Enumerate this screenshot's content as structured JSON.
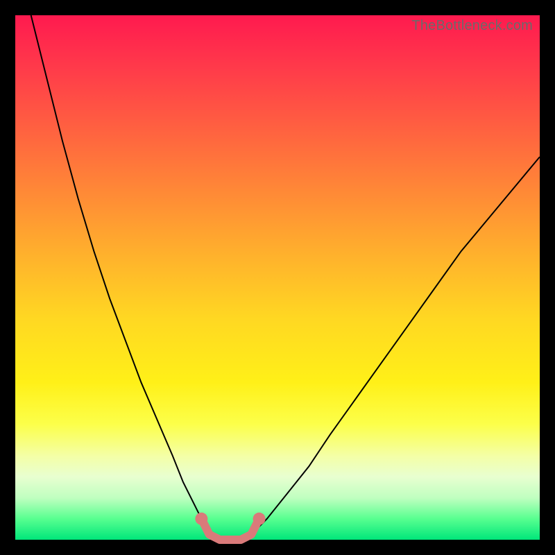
{
  "watermark": "TheBottleneck.com",
  "chart_data": {
    "type": "line",
    "title": "",
    "xlabel": "",
    "ylabel": "",
    "xlim": [
      0,
      100
    ],
    "ylim": [
      0,
      100
    ],
    "series": [
      {
        "name": "left-curve",
        "x": [
          3,
          6,
          9,
          12,
          15,
          18,
          21,
          24,
          27,
          30,
          32,
          34,
          35.5,
          37
        ],
        "values": [
          100,
          88,
          76,
          65,
          55,
          46,
          38,
          30,
          23,
          16,
          11,
          7,
          4,
          1
        ]
      },
      {
        "name": "right-curve",
        "x": [
          45,
          48,
          52,
          56,
          60,
          65,
          70,
          75,
          80,
          85,
          90,
          95,
          100
        ],
        "values": [
          1,
          4,
          9,
          14,
          20,
          27,
          34,
          41,
          48,
          55,
          61,
          67,
          73
        ]
      },
      {
        "name": "bottom-segment-pink",
        "x": [
          35.5,
          37,
          39,
          41,
          43,
          45,
          46.5
        ],
        "values": [
          4,
          1,
          0,
          0,
          0,
          1,
          4
        ]
      }
    ],
    "markers": [
      {
        "name": "left-dot",
        "x": 35.5,
        "y": 4
      },
      {
        "name": "right-dot",
        "x": 46.5,
        "y": 4
      }
    ],
    "colors": {
      "curve": "#000000",
      "segment": "#d97a7a",
      "marker": "#d97a7a"
    }
  }
}
